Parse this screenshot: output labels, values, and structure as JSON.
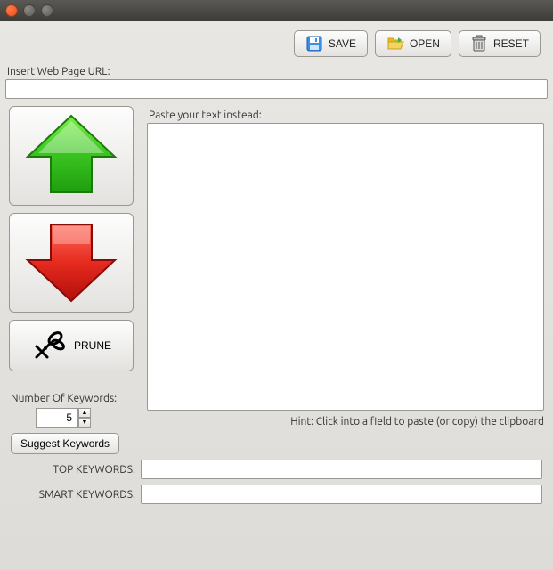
{
  "toolbar": {
    "save_label": "SAVE",
    "open_label": "OPEN",
    "reset_label": "RESET"
  },
  "labels": {
    "url": "Insert Web Page URL:",
    "paste_text": "Paste your text instead:",
    "prune": "PRUNE",
    "num_keywords": "Number Of Keywords:",
    "hint": "Hint: Click into a field to paste (or copy) the clipboard",
    "suggest": "Suggest Keywords",
    "top_keywords": "TOP KEYWORDS:",
    "smart_keywords": "SMART KEYWORDS:"
  },
  "values": {
    "url": "",
    "text": "",
    "num_keywords": "5",
    "top_keywords": "",
    "smart_keywords": ""
  }
}
